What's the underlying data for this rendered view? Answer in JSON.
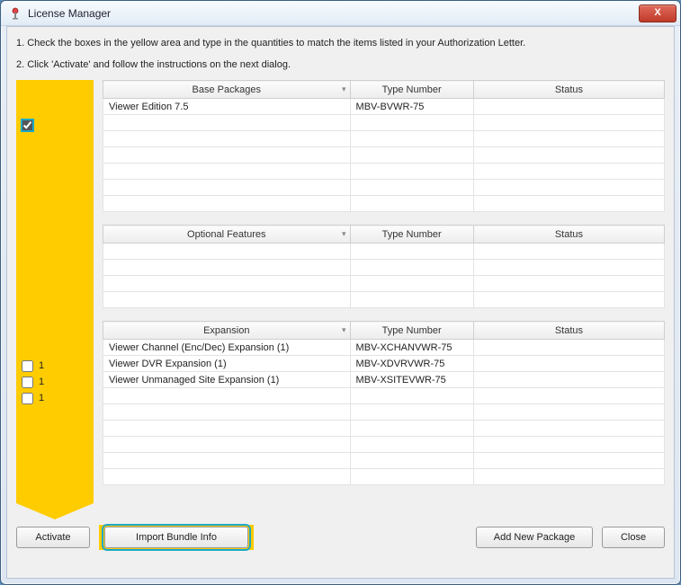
{
  "window": {
    "title": "License Manager"
  },
  "instructions": {
    "line1": "1. Check the boxes in the yellow area and type in the quantities to match the items listed in your Authorization Letter.",
    "line2": "2. Click 'Activate' and follow the instructions on the next dialog."
  },
  "columns": {
    "base": {
      "c1": "Base Packages",
      "c2": "Type Number",
      "c3": "Status"
    },
    "optional": {
      "c1": "Optional Features",
      "c2": "Type Number",
      "c3": "Status"
    },
    "expansion": {
      "c1": "Expansion",
      "c2": "Type Number",
      "c3": "Status"
    }
  },
  "base_rows": [
    {
      "checked": true,
      "name": "Viewer Edition 7.5",
      "type": "MBV-BVWR-75",
      "status": ""
    }
  ],
  "optional_rows": [],
  "expansion_rows": [
    {
      "checked": false,
      "qty": "1",
      "name": "Viewer Channel (Enc/Dec) Expansion (1)",
      "type": "MBV-XCHANVWR-75",
      "status": ""
    },
    {
      "checked": false,
      "qty": "1",
      "name": "Viewer DVR Expansion (1)",
      "type": "MBV-XDVRVWR-75",
      "status": ""
    },
    {
      "checked": false,
      "qty": "1",
      "name": "Viewer Unmanaged Site Expansion (1)",
      "type": "MBV-XSITEVWR-75",
      "status": ""
    }
  ],
  "buttons": {
    "activate": "Activate",
    "import": "Import Bundle Info",
    "add_pkg": "Add New Package",
    "close": "Close"
  },
  "icons": {
    "close_x": "X"
  }
}
